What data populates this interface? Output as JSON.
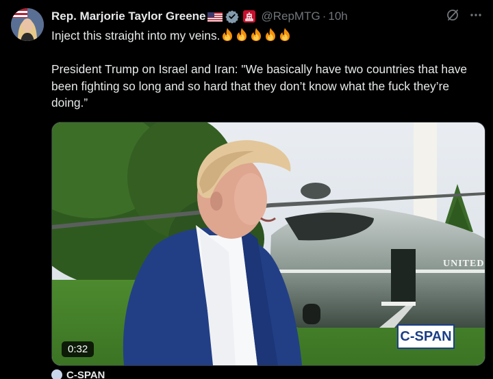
{
  "author": {
    "display_name": "Rep. Marjorie Taylor Greene",
    "handle": "@RepMTG",
    "separator": "·",
    "timestamp": "10h",
    "avatar_icon": "profile-avatar",
    "badges": [
      "us-flag-emoji",
      "verified-badge-icon",
      "affiliate-badge-icon"
    ]
  },
  "actions": {
    "grok_icon": "grok-icon",
    "more_icon": "more-horizontal-icon"
  },
  "tweet": {
    "line1": "Inject this straight into my veins.",
    "line1_emoji": [
      "fire-emoji",
      "fire-emoji",
      "fire-emoji",
      "fire-emoji",
      "fire-emoji"
    ],
    "quote_line": "President Trump on Israel and Iran: \"We basically have two countries that have been fighting so long and so hard that they don’t know what the fuck they’re doing.”"
  },
  "media": {
    "duration": "0:32",
    "channel_logo": "C-SPAN",
    "helicopter_text": "UNITED"
  },
  "quoted": {
    "name": "C-SPAN"
  },
  "colors": {
    "background": "#000000",
    "primary_text": "#e7e9ea",
    "secondary_text": "#71767b",
    "verified_grey": "#829aab",
    "cspan_blue": "#1b3f86"
  }
}
